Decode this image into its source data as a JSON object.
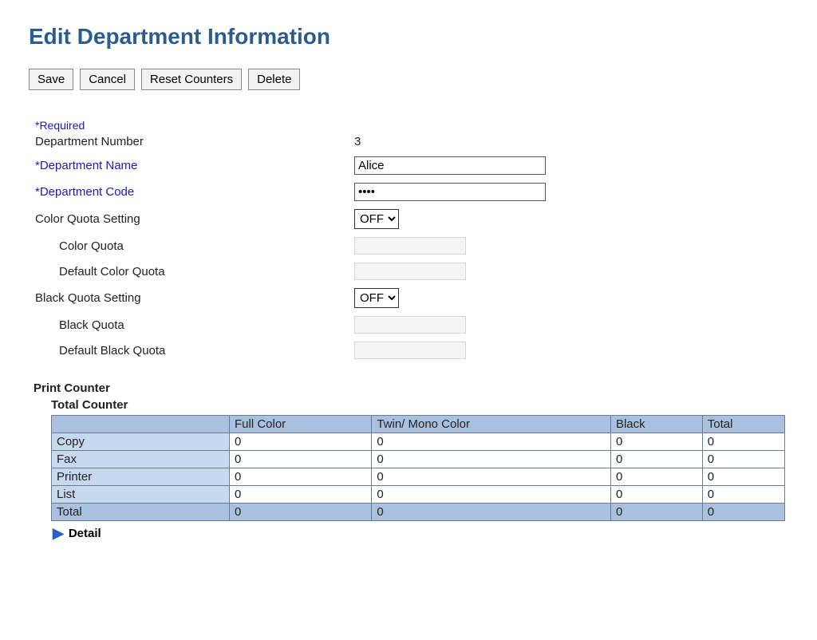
{
  "title": "Edit Department Information",
  "toolbar": {
    "save": "Save",
    "cancel": "Cancel",
    "reset": "Reset Counters",
    "delete": "Delete"
  },
  "required_note": "*Required",
  "fields": {
    "number_label": "Department Number",
    "number_value": "3",
    "name_label": "*Department Name",
    "name_value": "Alice",
    "code_label": "*Department Code",
    "code_value": "••••",
    "color_setting_label": "Color Quota Setting",
    "color_setting_value": "OFF",
    "color_quota_label": "Color Quota",
    "color_quota_value": "",
    "default_color_quota_label": "Default Color Quota",
    "default_color_quota_value": "",
    "black_setting_label": "Black Quota Setting",
    "black_setting_value": "OFF",
    "black_quota_label": "Black Quota",
    "black_quota_value": "",
    "default_black_quota_label": "Default Black Quota",
    "default_black_quota_value": ""
  },
  "print_counter_heading": "Print Counter",
  "total_counter_heading": "Total Counter",
  "counter": {
    "columns": [
      "",
      "Full Color",
      "Twin/ Mono Color",
      "Black",
      "Total"
    ],
    "rows": [
      {
        "label": "Copy",
        "full": "0",
        "twin": "0",
        "black": "0",
        "total": "0"
      },
      {
        "label": "Fax",
        "full": "0",
        "twin": "0",
        "black": "0",
        "total": "0"
      },
      {
        "label": "Printer",
        "full": "0",
        "twin": "0",
        "black": "0",
        "total": "0"
      },
      {
        "label": "List",
        "full": "0",
        "twin": "0",
        "black": "0",
        "total": "0"
      },
      {
        "label": "Total",
        "full": "0",
        "twin": "0",
        "black": "0",
        "total": "0"
      }
    ]
  },
  "detail_label": "Detail"
}
